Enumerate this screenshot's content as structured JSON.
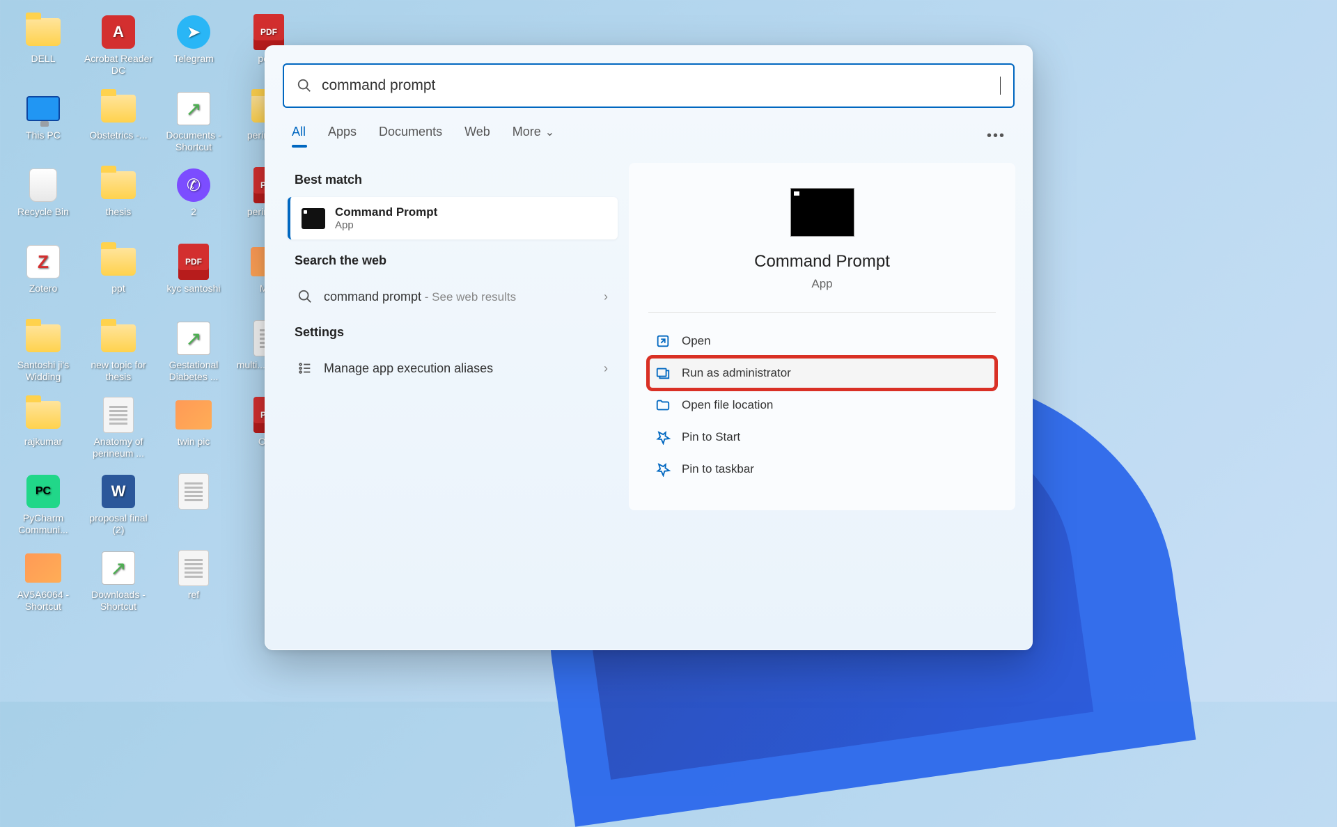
{
  "desktop": {
    "icons": [
      {
        "label": "DELL",
        "type": "folder"
      },
      {
        "label": "This PC",
        "type": "monitor"
      },
      {
        "label": "Recycle Bin",
        "type": "bin"
      },
      {
        "label": "Zotero",
        "type": "zot"
      },
      {
        "label": "Santoshi ji's Widding",
        "type": "folder"
      },
      {
        "label": "rajkumar",
        "type": "folder"
      },
      {
        "label": "PyCharm Communi...",
        "type": "pyc"
      },
      {
        "label": "AV5A6064 - Shortcut",
        "type": "img"
      },
      {
        "label": "",
        "type": "blank"
      },
      {
        "label": "Acrobat Reader DC",
        "type": "appred",
        "glyph": "A"
      },
      {
        "label": "Obstetrics -...",
        "type": "folder"
      },
      {
        "label": "thesis",
        "type": "folder"
      },
      {
        "label": "ppt",
        "type": "folder"
      },
      {
        "label": "new topic for thesis",
        "type": "folder"
      },
      {
        "label": "Anatomy of perineum ...",
        "type": "docx"
      },
      {
        "label": "proposal final (2)",
        "type": "word"
      },
      {
        "label": "",
        "type": "blank"
      },
      {
        "label": "Downloads - Shortcut",
        "type": "shortcut"
      },
      {
        "label": "Telegram",
        "type": "tg"
      },
      {
        "label": "Documents - Shortcut",
        "type": "shortcut"
      },
      {
        "label": "2",
        "type": "vib"
      },
      {
        "label": "kyc santoshi",
        "type": "pdf"
      },
      {
        "label": "Gestational Diabetes ...",
        "type": "shortcut"
      },
      {
        "label": "twin pic",
        "type": "img"
      },
      {
        "label": "",
        "type": "blank"
      },
      {
        "label": "",
        "type": "docx"
      },
      {
        "label": "ref",
        "type": "docx"
      },
      {
        "label": "perin",
        "type": "pdf"
      },
      {
        "label": "perin anat",
        "type": "folder"
      },
      {
        "label": "perin rcog",
        "type": "pdf"
      },
      {
        "label": "Mes",
        "type": "img"
      },
      {
        "label": "",
        "type": "blank"
      },
      {
        "label": "multi... pregn...",
        "type": "docx"
      },
      {
        "label": "Oh...",
        "type": "pdf"
      }
    ]
  },
  "search": {
    "query": "command prompt",
    "tabs": [
      "All",
      "Apps",
      "Documents",
      "Web",
      "More"
    ],
    "sections": {
      "best_match": "Best match",
      "search_web": "Search the web",
      "settings": "Settings"
    },
    "best": {
      "title": "Command Prompt",
      "sub": "App"
    },
    "web": {
      "term": "command prompt",
      "suffix": " - See web results"
    },
    "settings_item": "Manage app execution aliases",
    "preview": {
      "title": "Command Prompt",
      "sub": "App",
      "actions": [
        {
          "icon": "open",
          "label": "Open"
        },
        {
          "icon": "admin",
          "label": "Run as administrator",
          "hl": true
        },
        {
          "icon": "folder",
          "label": "Open file location"
        },
        {
          "icon": "pin",
          "label": "Pin to Start"
        },
        {
          "icon": "pin",
          "label": "Pin to taskbar"
        }
      ]
    }
  }
}
